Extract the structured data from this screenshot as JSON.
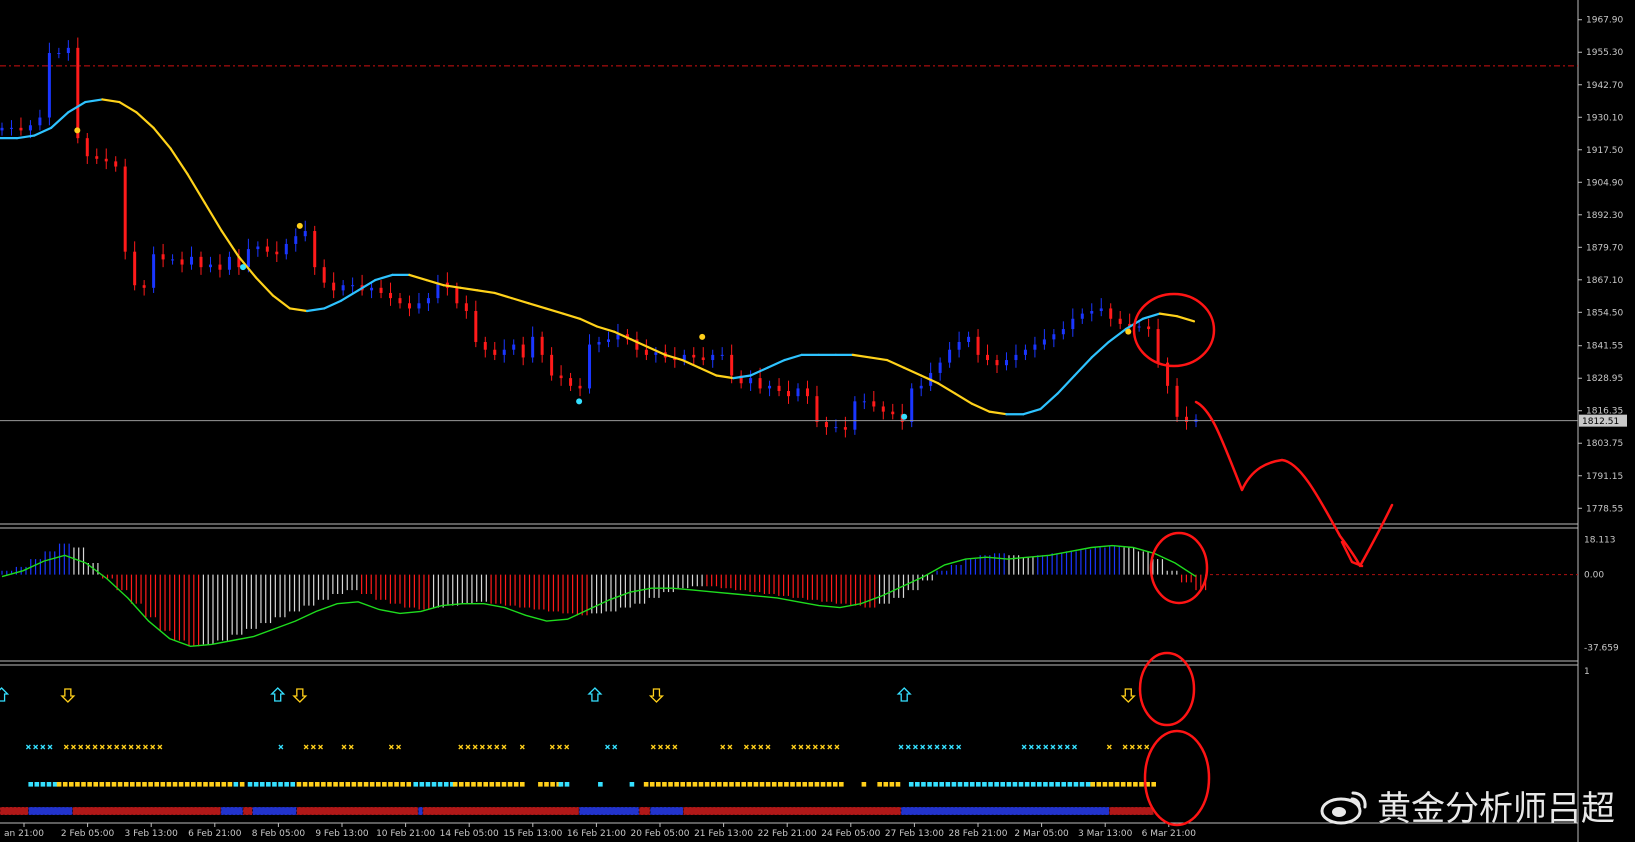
{
  "watermark": {
    "text": "黄金分析师吕超",
    "icon": "weibo-logo-icon"
  },
  "colors": {
    "background": "#000000",
    "bull": "#1a36ff",
    "bear": "#ff1a1a",
    "ma_up": "#2ec3ff",
    "ma_down": "#ffd21a",
    "cyan": "#35e0ff",
    "yellow": "#ffcf1a",
    "signal_line": "#1edc1e",
    "annotation": "#ff1414"
  },
  "chart_data": [
    {
      "type": "candlestick",
      "price_axis": [
        1967.9,
        1955.3,
        1942.7,
        1930.1,
        1917.5,
        1904.9,
        1892.3,
        1879.7,
        1867.1,
        1854.5,
        1841.55,
        1828.95,
        1816.35,
        1803.75,
        1791.15,
        1778.55
      ],
      "ylim": [
        1774,
        1974
      ],
      "current_price": 1812.51,
      "resistance_line": 1950.0,
      "x_tick_labels": [
        "an 21:00",
        "2 Feb 05:00",
        "3 Feb 13:00",
        "6 Feb 21:00",
        "8 Feb 05:00",
        "9 Feb 13:00",
        "10 Feb 21:00",
        "14 Feb 05:00",
        "15 Feb 13:00",
        "16 Feb 21:00",
        "20 Feb 05:00",
        "21 Feb 13:00",
        "22 Feb 21:00",
        "24 Feb 05:00",
        "27 Feb 13:00",
        "28 Feb 21:00",
        "2 Mar 05:00",
        "3 Mar 13:00",
        "6 Mar 21:00"
      ],
      "close_series": [
        1926,
        1926,
        1925,
        1927,
        1930,
        1955,
        1955,
        1957,
        1922,
        1915,
        1914,
        1913,
        1911,
        1878,
        1865,
        1864,
        1877,
        1875,
        1875,
        1873,
        1876,
        1872,
        1873,
        1871,
        1876,
        1872,
        1879,
        1880,
        1878,
        1877,
        1881,
        1884,
        1886,
        1872,
        1866,
        1863,
        1865,
        1865,
        1863,
        1864,
        1862,
        1860,
        1858,
        1856,
        1858,
        1860,
        1866,
        1864,
        1858,
        1855,
        1843,
        1840,
        1838,
        1840,
        1842,
        1837,
        1845,
        1838,
        1830,
        1829,
        1826,
        1825,
        1842,
        1843,
        1844,
        1846,
        1844,
        1840,
        1838,
        1839,
        1837,
        1836,
        1838,
        1837,
        1836,
        1838,
        1838,
        1830,
        1827,
        1829,
        1825,
        1826,
        1824,
        1822,
        1825,
        1822,
        1812,
        1810,
        1810,
        1809,
        1820,
        1820,
        1818,
        1816,
        1815,
        1812,
        1825,
        1826,
        1831,
        1835,
        1840,
        1843,
        1845,
        1838,
        1836,
        1834,
        1836,
        1838,
        1840,
        1842,
        1844,
        1846,
        1848,
        1852,
        1854,
        1855,
        1856,
        1852,
        1850,
        1849,
        1849,
        1848,
        1835,
        1826,
        1814,
        1812,
        1813
      ],
      "ma_series": [
        1922,
        1922,
        1923,
        1926,
        1932,
        1936,
        1937,
        1936,
        1932,
        1926,
        1918,
        1908,
        1897,
        1886,
        1876,
        1868,
        1861,
        1856,
        1855,
        1856,
        1859,
        1863,
        1867,
        1869,
        1869,
        1867,
        1865,
        1864,
        1863,
        1862,
        1860,
        1858,
        1856,
        1854,
        1852,
        1849,
        1847,
        1844,
        1841,
        1838,
        1836,
        1833,
        1830,
        1829,
        1830,
        1833,
        1836,
        1838,
        1838,
        1838,
        1838,
        1837,
        1836,
        1833,
        1830,
        1827,
        1823,
        1819,
        1816,
        1815,
        1815,
        1817,
        1823,
        1830,
        1837,
        1843,
        1848,
        1852,
        1854,
        1853,
        1851
      ],
      "dot_markers": [
        {
          "x": 0.049,
          "y": 1925,
          "color": "yellow"
        },
        {
          "x": 0.154,
          "y": 1872,
          "color": "cyan"
        },
        {
          "x": 0.19,
          "y": 1888,
          "color": "yellow"
        },
        {
          "x": 0.367,
          "y": 1820,
          "color": "cyan"
        },
        {
          "x": 0.445,
          "y": 1845,
          "color": "yellow"
        },
        {
          "x": 0.573,
          "y": 1814,
          "color": "cyan"
        },
        {
          "x": 0.715,
          "y": 1847,
          "color": "yellow"
        }
      ]
    },
    {
      "type": "bar",
      "axis_labels": [
        "18.113",
        "0.00",
        "-37.659"
      ],
      "ylim": [
        -42,
        22
      ],
      "histogram": [
        2,
        4,
        8,
        12,
        16,
        14,
        6,
        -2,
        -8,
        -15,
        -22,
        -29,
        -34,
        -37,
        -36,
        -34,
        -31,
        -28,
        -25,
        -22,
        -19,
        -16,
        -13,
        -10,
        -8,
        -10,
        -13,
        -15,
        -17,
        -18,
        -17,
        -16,
        -15,
        -14,
        -15,
        -16,
        -17,
        -18,
        -19,
        -20,
        -21,
        -20,
        -19,
        -17,
        -15,
        -12,
        -9,
        -7,
        -6,
        -6,
        -7,
        -8,
        -9,
        -10,
        -11,
        -12,
        -13,
        -14,
        -15,
        -16,
        -17,
        -15,
        -12,
        -8,
        -3,
        2,
        5,
        8,
        10,
        11,
        10,
        9,
        10,
        11,
        12,
        13,
        14,
        15,
        14,
        12,
        8,
        2,
        -4,
        -8
      ],
      "signal": [
        -1,
        2,
        7,
        10,
        6,
        -2,
        -12,
        -24,
        -33,
        -37,
        -36,
        -34,
        -32,
        -28,
        -24,
        -19,
        -15,
        -14,
        -18,
        -20,
        -19,
        -16,
        -15,
        -15,
        -17,
        -21,
        -24,
        -23,
        -18,
        -13,
        -9,
        -7,
        -7,
        -8,
        -9,
        -10,
        -11,
        -12,
        -14,
        -16,
        -17,
        -15,
        -11,
        -6,
        -1,
        5,
        8,
        9,
        8,
        9,
        10,
        12,
        14,
        15,
        14,
        11,
        6,
        -1
      ]
    }
  ],
  "signal_panel": {
    "scale_label": "1",
    "arrows": [
      {
        "x": 0.001,
        "dir": "up"
      },
      {
        "x": 0.043,
        "dir": "down"
      },
      {
        "x": 0.176,
        "dir": "up"
      },
      {
        "x": 0.19,
        "dir": "down"
      },
      {
        "x": 0.377,
        "dir": "up"
      },
      {
        "x": 0.416,
        "dir": "down"
      },
      {
        "x": 0.573,
        "dir": "up"
      },
      {
        "x": 0.715,
        "dir": "down"
      }
    ],
    "cross_groups": [
      {
        "x": 0.018,
        "n": 4,
        "color": "cyan"
      },
      {
        "x": 0.042,
        "n": 14,
        "color": "yellow"
      },
      {
        "x": 0.178,
        "n": 1,
        "color": "cyan"
      },
      {
        "x": 0.194,
        "n": 3,
        "color": "yellow"
      },
      {
        "x": 0.218,
        "n": 2,
        "color": "yellow"
      },
      {
        "x": 0.248,
        "n": 2,
        "color": "yellow"
      },
      {
        "x": 0.292,
        "n": 7,
        "color": "yellow"
      },
      {
        "x": 0.331,
        "n": 1,
        "color": "yellow"
      },
      {
        "x": 0.35,
        "n": 3,
        "color": "yellow"
      },
      {
        "x": 0.385,
        "n": 2,
        "color": "cyan"
      },
      {
        "x": 0.414,
        "n": 4,
        "color": "yellow"
      },
      {
        "x": 0.458,
        "n": 2,
        "color": "yellow"
      },
      {
        "x": 0.473,
        "n": 4,
        "color": "yellow"
      },
      {
        "x": 0.503,
        "n": 7,
        "color": "yellow"
      },
      {
        "x": 0.571,
        "n": 9,
        "color": "cyan"
      },
      {
        "x": 0.649,
        "n": 8,
        "color": "cyan"
      },
      {
        "x": 0.703,
        "n": 1,
        "color": "yellow"
      },
      {
        "x": 0.713,
        "n": 4,
        "color": "yellow"
      }
    ],
    "square_segments": [
      {
        "from": 0.018,
        "to": 0.036,
        "color": "cyan"
      },
      {
        "from": 0.036,
        "to": 0.148,
        "color": "yellow"
      },
      {
        "from": 0.148,
        "to": 0.152,
        "color": "cyan"
      },
      {
        "from": 0.152,
        "to": 0.157,
        "color": "yellow"
      },
      {
        "from": 0.157,
        "to": 0.188,
        "color": "cyan"
      },
      {
        "from": 0.188,
        "to": 0.262,
        "color": "yellow"
      },
      {
        "from": 0.262,
        "to": 0.287,
        "color": "cyan"
      },
      {
        "from": 0.287,
        "to": 0.333,
        "color": "yellow"
      },
      {
        "from": 0.341,
        "to": 0.354,
        "color": "yellow"
      },
      {
        "from": 0.354,
        "to": 0.36,
        "color": "cyan"
      },
      {
        "from": 0.379,
        "to": 0.383,
        "color": "cyan"
      },
      {
        "from": 0.399,
        "to": 0.403,
        "color": "cyan"
      },
      {
        "from": 0.408,
        "to": 0.534,
        "color": "yellow"
      },
      {
        "from": 0.546,
        "to": 0.55,
        "color": "yellow"
      },
      {
        "from": 0.556,
        "to": 0.569,
        "color": "yellow"
      },
      {
        "from": 0.576,
        "to": 0.691,
        "color": "cyan"
      },
      {
        "from": 0.691,
        "to": 0.731,
        "color": "yellow"
      }
    ],
    "strip_segments": [
      {
        "from": 0.0,
        "to": 0.018,
        "color": "bear"
      },
      {
        "from": 0.018,
        "to": 0.046,
        "color": "bull"
      },
      {
        "from": 0.046,
        "to": 0.14,
        "color": "bear"
      },
      {
        "from": 0.14,
        "to": 0.154,
        "color": "bull"
      },
      {
        "from": 0.154,
        "to": 0.16,
        "color": "bear"
      },
      {
        "from": 0.16,
        "to": 0.188,
        "color": "bull"
      },
      {
        "from": 0.188,
        "to": 0.265,
        "color": "bear"
      },
      {
        "from": 0.265,
        "to": 0.268,
        "color": "bull"
      },
      {
        "from": 0.268,
        "to": 0.367,
        "color": "bear"
      },
      {
        "from": 0.367,
        "to": 0.405,
        "color": "bull"
      },
      {
        "from": 0.405,
        "to": 0.412,
        "color": "bear"
      },
      {
        "from": 0.412,
        "to": 0.433,
        "color": "bull"
      },
      {
        "from": 0.433,
        "to": 0.571,
        "color": "bear"
      },
      {
        "from": 0.571,
        "to": 0.703,
        "color": "bull"
      },
      {
        "from": 0.703,
        "to": 0.731,
        "color": "bear"
      }
    ]
  }
}
